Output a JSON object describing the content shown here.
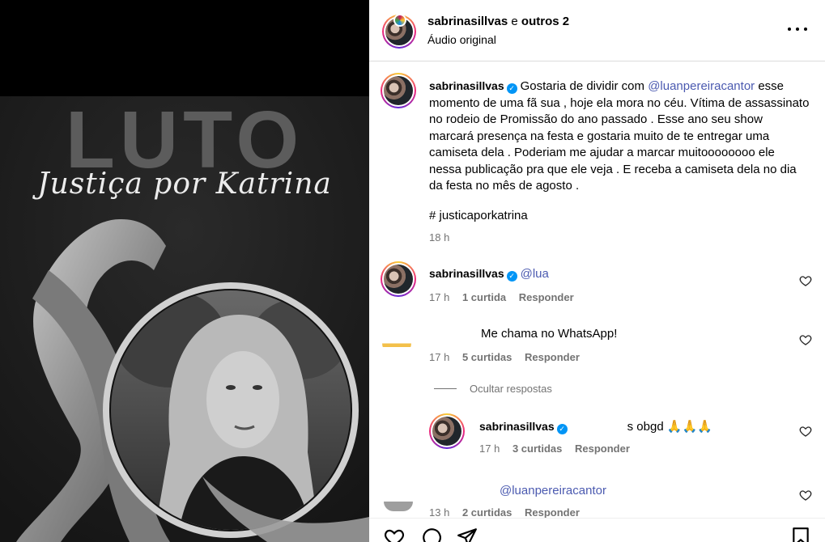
{
  "post": {
    "poster_title": "LUTO",
    "poster_subtitle": "Justiça por Katrina"
  },
  "header": {
    "author": "sabrinasillvas",
    "connector": " e ",
    "others": "outros 2",
    "audio": "Áudio original",
    "more_icon": "more-horizontal-icon"
  },
  "caption": {
    "username": "sabrinasillvas",
    "text_before": "Gostaria de dividir com ",
    "mention": "@luanpereiracantor",
    "text_after": " esse momento de uma fã sua , hoje ela mora no céu. Vítima de assassinato no rodeio de Promissão do ano passado . Esse ano seu show marcará presença na festa e gostaria muito de te entregar uma camiseta dela . Poderiam me ajudar a marcar muitoooooooo ele nessa publicação pra que ele veja . E receba a camiseta dela no dia da festa no mês de agosto .",
    "hashtag": "# justicaporkatrina",
    "time": "18 h"
  },
  "comments": [
    {
      "username": "sabrinasillvas",
      "text": "@lua",
      "time": "17 h",
      "likes": "1 curtida",
      "reply": "Responder"
    },
    {
      "text": "Me chama no WhatsApp!",
      "time": "17 h",
      "likes": "5 curtidas",
      "reply": "Responder"
    }
  ],
  "hide_replies": "Ocultar respostas",
  "replies": [
    {
      "username": "sabrinasillvas",
      "text": "s obgd 🙏🙏🙏",
      "time": "17 h",
      "likes": "3 curtidas",
      "reply": "Responder"
    },
    {
      "text": "@luanpereiracantor",
      "time": "13 h",
      "likes": "2 curtidas",
      "reply": "Responder"
    }
  ],
  "colors": {
    "mention": "#4b5ab0",
    "verified": "#0095f6",
    "meta": "#737373"
  }
}
